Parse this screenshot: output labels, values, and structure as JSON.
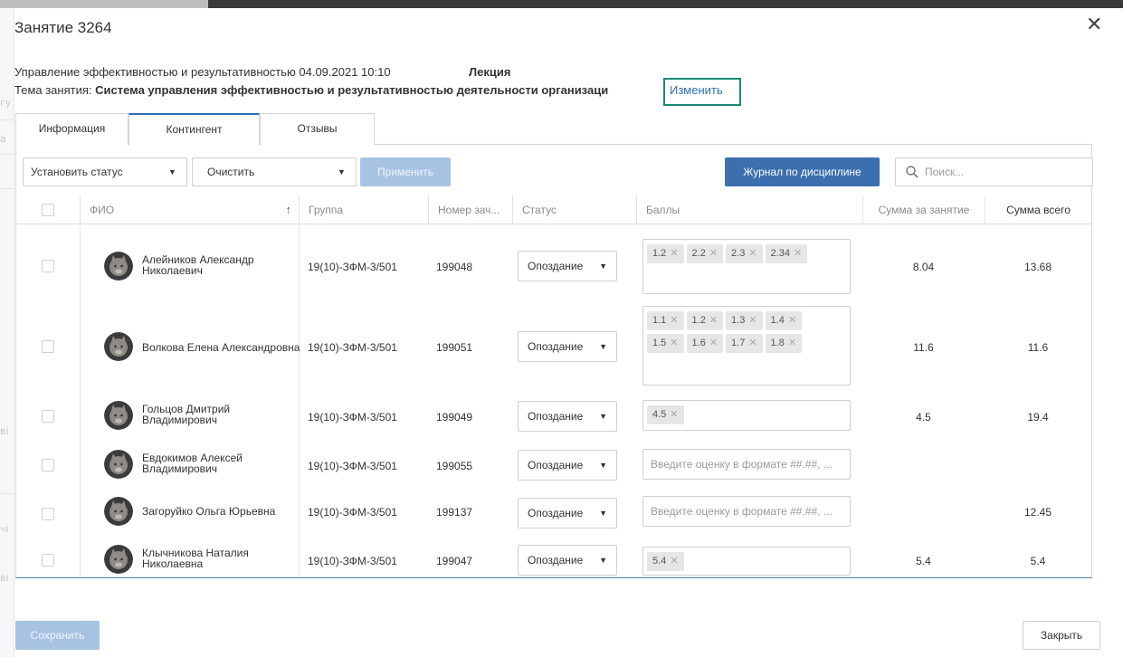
{
  "modal": {
    "title": "Занятие 3264",
    "close_glyph": "✕"
  },
  "lesson": {
    "line1": "Управление эффективностью и результативностью 04.09.2021 10:10",
    "type": "Лекция",
    "topic_label": "Тема занятия: ",
    "topic_value": "Система управления эффективностью и результативностью деятельности организаци",
    "change_link": "Изменить"
  },
  "tabs": [
    {
      "label": "Информация",
      "active": false
    },
    {
      "label": "Контингент",
      "active": true
    },
    {
      "label": "Отзывы",
      "active": false
    }
  ],
  "toolbar": {
    "set_status": "Установить статус",
    "clear": "Очистить",
    "apply": "Применить",
    "journal": "Журнал по дисциплине",
    "search_placeholder": "Поиск..."
  },
  "table": {
    "columns": [
      "ФИО",
      "Группа",
      "Номер зач...",
      "Статус",
      "Баллы",
      "Сумма за занятие",
      "Сумма всего"
    ],
    "score_placeholder": "Введите оценку в формате ##.##, ...",
    "rows": [
      {
        "fio": [
          "Алейников Александр",
          "Николаевич"
        ],
        "group": "19(10)-ЗФМ-3/501",
        "record": "199048",
        "status": "Опоздание",
        "scores": [
          "1.2",
          "2.2",
          "2.3",
          "2.34"
        ],
        "sum_lesson": "8.04",
        "sum_total": "13.68"
      },
      {
        "fio": [
          "Волкова Елена Александровна"
        ],
        "group": "19(10)-ЗФМ-3/501",
        "record": "199051",
        "status": "Опоздание",
        "scores": [
          "1.1",
          "1.2",
          "1.3",
          "1.4",
          "1.5",
          "1.6",
          "1.7",
          "1.8"
        ],
        "sum_lesson": "11.6",
        "sum_total": "11.6"
      },
      {
        "fio": [
          "Гольцов Дмитрий",
          "Владимирович"
        ],
        "group": "19(10)-ЗФМ-3/501",
        "record": "199049",
        "status": "Опоздание",
        "scores": [
          "4.5"
        ],
        "sum_lesson": "4.5",
        "sum_total": "19.4"
      },
      {
        "fio": [
          "Евдокимов Алексей",
          "Владимирович"
        ],
        "group": "19(10)-ЗФМ-3/501",
        "record": "199055",
        "status": "Опоздание",
        "scores": [],
        "sum_lesson": "",
        "sum_total": ""
      },
      {
        "fio": [
          "Загоруйко Ольга Юрьевна"
        ],
        "group": "19(10)-ЗФМ-3/501",
        "record": "199137",
        "status": "Опоздание",
        "scores": [],
        "sum_lesson": "",
        "sum_total": "12.45"
      },
      {
        "fio": [
          "Клычникова Наталия",
          "Николаевна"
        ],
        "group": "19(10)-ЗФМ-3/501",
        "record": "199047",
        "status": "Опоздание",
        "scores": [
          "5.4"
        ],
        "sum_lesson": "5.4",
        "sum_total": "5.4"
      }
    ]
  },
  "footer": {
    "save": "Сохранить",
    "close": "Закрыть"
  },
  "background_fragments": [
    "гу",
    "а",
    "ві",
    "чі",
    "ві"
  ],
  "colors": {
    "primary": "#3c6fb0",
    "primary_disabled": "#a7c3e4",
    "link": "#2f6fb8",
    "highlight_box": "#1a8a76"
  }
}
